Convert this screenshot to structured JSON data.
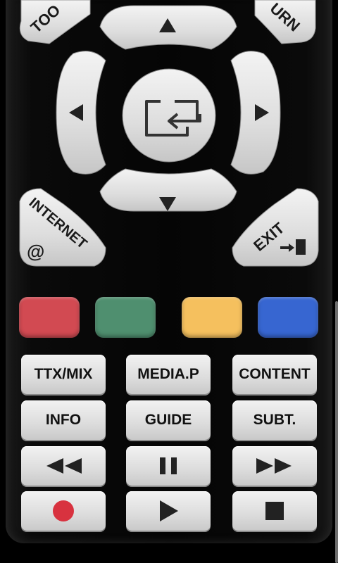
{
  "remote": {
    "top_left_label": "TOO",
    "top_right_label": "URN",
    "internet_label": "INTERNET",
    "internet_at": "@",
    "exit_label": "EXIT"
  },
  "color_buttons": [
    {
      "name": "red-button",
      "color": "#d24a52"
    },
    {
      "name": "green-button",
      "color": "#4f8f6f"
    },
    {
      "name": "yellow-button",
      "color": "#f5c05e"
    },
    {
      "name": "blue-button",
      "color": "#3766d1"
    }
  ],
  "buttons": {
    "row1": [
      "TTX/MIX",
      "MEDIA.P",
      "CONTENT"
    ],
    "row2": [
      "INFO",
      "GUIDE",
      "SUBT."
    ]
  },
  "icons": {
    "rewind": "rewind-icon",
    "pause": "pause-icon",
    "fast_forward": "fast-forward-icon",
    "record": "record-icon",
    "play": "play-icon",
    "stop": "stop-icon",
    "source": "source-input-icon"
  },
  "accent": {
    "record": "#d8323f"
  }
}
